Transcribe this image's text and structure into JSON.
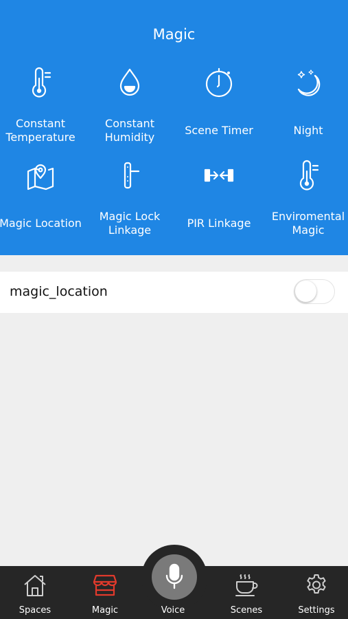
{
  "header": {
    "title": "Magic",
    "tiles": [
      {
        "label": "Constant\nTemperature",
        "icon": "thermometer-icon"
      },
      {
        "label": "Constant\nHumidity",
        "icon": "water-drop-icon"
      },
      {
        "label": "Scene Timer",
        "icon": "timer-icon"
      },
      {
        "label": "Night",
        "icon": "moon-stars-icon"
      },
      {
        "label": "Magic Location",
        "icon": "map-location-icon"
      },
      {
        "label": "Magic Lock\nLinkage",
        "icon": "door-lock-icon"
      },
      {
        "label": "PIR Linkage",
        "icon": "pir-sensor-icon"
      },
      {
        "label": "Enviromental\nMagic",
        "icon": "thermometer-icon"
      }
    ]
  },
  "list": {
    "items": [
      {
        "label": "magic_location",
        "enabled": false
      }
    ]
  },
  "tabbar": {
    "tabs": [
      {
        "label": "Spaces",
        "icon": "house-icon"
      },
      {
        "label": "Magic",
        "icon": "store-icon",
        "active": true
      },
      {
        "label": "Voice",
        "icon": "microphone-icon"
      },
      {
        "label": "Scenes",
        "icon": "coffee-cup-icon"
      },
      {
        "label": "Settings",
        "icon": "gear-icon"
      }
    ],
    "active_color": "#e23a2c"
  },
  "colors": {
    "header_bg": "#1f86e4",
    "page_bg": "#efefef",
    "tabbar_bg": "#262626"
  }
}
